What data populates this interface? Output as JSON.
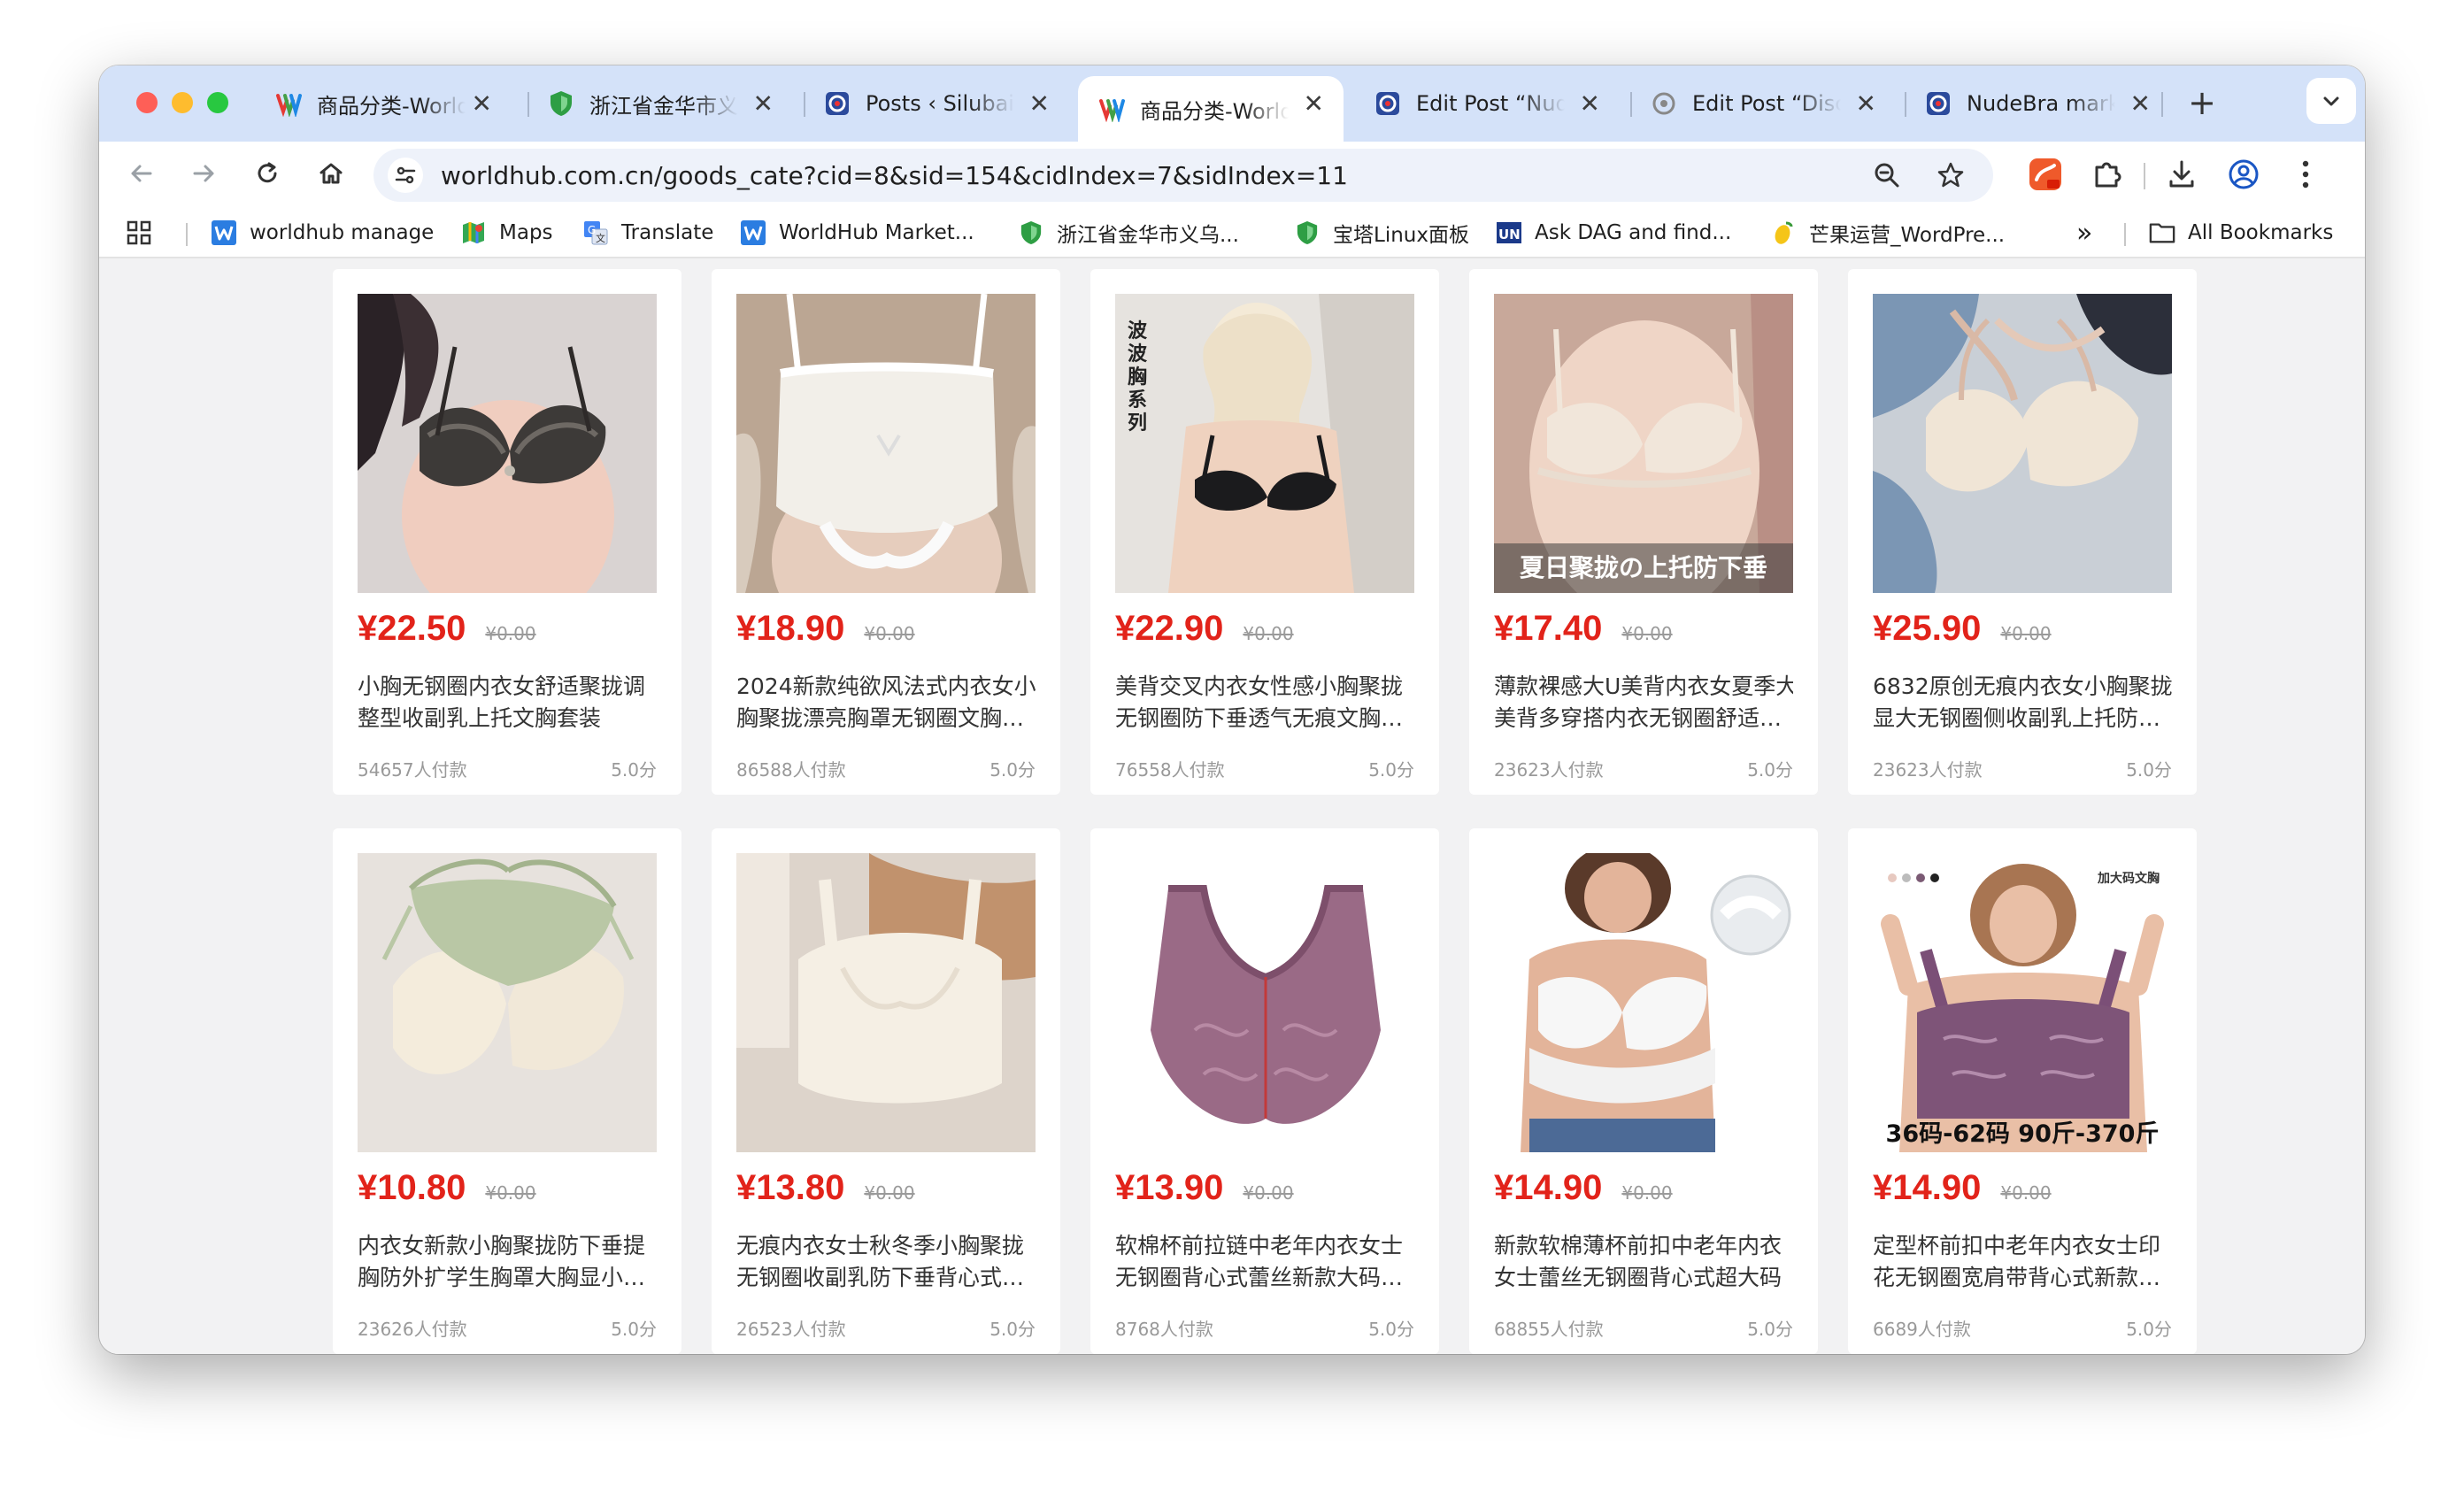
{
  "browser": {
    "tabs": [
      {
        "title": "商品分类-WorldHub",
        "favicon": "worldhub-icon",
        "active": false
      },
      {
        "title": "浙江省金华市义乌",
        "favicon": "shield-icon",
        "active": false
      },
      {
        "title": "Posts ‹ Silubai",
        "favicon": "wordpress-icon",
        "active": false
      },
      {
        "title": "商品分类-WorldHub",
        "favicon": "worldhub-icon",
        "active": true
      },
      {
        "title": "Edit Post “Nude",
        "favicon": "wordpress-icon",
        "active": false
      },
      {
        "title": "Edit Post “Disc",
        "favicon": "wordpress-icon",
        "active": false
      },
      {
        "title": "NudeBra market",
        "favicon": "wordpress-icon",
        "active": false
      }
    ],
    "url": "worldhub.com.cn/goods_cate?cid=8&sid=154&cidIndex=7&sidIndex=11",
    "bookmarks": [
      {
        "label": "worldhub manage",
        "icon": "w-icon"
      },
      {
        "label": "Maps",
        "icon": "maps-icon"
      },
      {
        "label": "Translate",
        "icon": "translate-icon"
      },
      {
        "label": "WorldHub Market...",
        "icon": "w-icon"
      },
      {
        "label": "浙江省金华市义乌...",
        "icon": "shield-icon"
      },
      {
        "label": "宝塔Linux面板",
        "icon": "shield-icon"
      },
      {
        "label": "Ask DAG and find...",
        "icon": "un-icon"
      },
      {
        "label": "芒果运营_WordPre...",
        "icon": "mango-icon"
      }
    ],
    "all_bookmarks": "All Bookmarks",
    "chevron": "»",
    "colors": {
      "tabstrip": "#d4e2f9",
      "price": "#e2231a"
    }
  },
  "products": [
    {
      "price": "¥22.50",
      "old_price": "¥0.00",
      "title_line1": "小胸无钢圈内衣女舒适聚拢调",
      "title_line2": "整型收副乳上托文胸套装",
      "sales": "54657人付款",
      "rating": "5.0分",
      "image": "black-lace-bra"
    },
    {
      "price": "¥18.90",
      "old_price": "¥0.00",
      "title_line1": "2024新款纯欲风法式内衣女小",
      "title_line2": "胸聚拢漂亮胸罩无钢圈文胸套装",
      "sales": "86588人付款",
      "rating": "5.0分",
      "image": "white-lace-bandeau"
    },
    {
      "price": "¥22.90",
      "old_price": "¥0.00",
      "title_line1": "美背交叉内衣女性感小胸聚拢",
      "title_line2": "无钢圈防下垂透气无痕文胸套装",
      "sales": "76558人付款",
      "rating": "5.0分",
      "image": "black-bra-model",
      "overlay": "波波胸系列"
    },
    {
      "price": "¥17.40",
      "old_price": "¥0.00",
      "title_line1": "薄款裸感大U美背内衣女夏季大",
      "title_line2": "美背多穿搭内衣无钢圈舒适文胸",
      "sales": "23623人付款",
      "rating": "5.0分",
      "image": "cream-bra-model",
      "overlay": "夏日聚拢の上托防下垂"
    },
    {
      "price": "¥25.90",
      "old_price": "¥0.00",
      "title_line1": "6832原创无痕内衣女小胸聚拢",
      "title_line2": "显大无钢圈侧收副乳上托防下垂",
      "sales": "23623人付款",
      "rating": "5.0分",
      "image": "beige-bras-flatlay"
    },
    {
      "price": "¥10.80",
      "old_price": "¥0.00",
      "title_line1": "内衣女新款小胸聚拢防下垂提",
      "title_line2": "胸防外扩学生胸罩大胸显小文胸",
      "sales": "23626人付款",
      "rating": "5.0分",
      "image": "green-cream-lace-bra"
    },
    {
      "price": "¥13.80",
      "old_price": "¥0.00",
      "title_line1": "无痕内衣女士秋冬季小胸聚拢",
      "title_line2": "无钢圈收副乳防下垂背心式文胸",
      "sales": "26523人付款",
      "rating": "5.0分",
      "image": "seamless-bras"
    },
    {
      "price": "¥13.90",
      "old_price": "¥0.00",
      "title_line1": "软棉杯前拉链中老年内衣女士",
      "title_line2": "无钢圈背心式蕾丝新款大码文胸",
      "sales": "8768人付款",
      "rating": "5.0分",
      "image": "purple-front-zip-bra"
    },
    {
      "price": "¥14.90",
      "old_price": "¥0.00",
      "title_line1": "新款软棉薄杯前扣中老年内衣",
      "title_line2": "女士蕾丝无钢圈背心式超大码",
      "sales": "68855人付款",
      "rating": "5.0分",
      "image": "white-plus-size-bra"
    },
    {
      "price": "¥14.90",
      "old_price": "¥0.00",
      "title_line1": "定型杯前扣中老年内衣女士印",
      "title_line2": "花无钢圈宽肩带背心式新款大码",
      "sales": "6689人付款",
      "rating": "5.0分",
      "image": "purple-plus-size-bra",
      "overlay": "36码-62码 90斤-370斤",
      "overlay_top": "加大码文胸"
    }
  ]
}
